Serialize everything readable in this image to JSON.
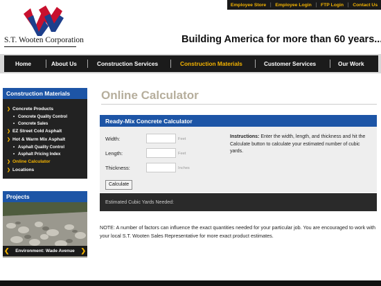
{
  "top_links": [
    "Employee Store",
    "Employee Login",
    "FTP Login",
    "Contact Us"
  ],
  "company": "S.T. Wooten Corporation",
  "tagline": "Building America for more than 60 years...",
  "nav": [
    "Home",
    "About Us",
    "Construction Services",
    "Construction Materials",
    "Customer Services",
    "Our Work"
  ],
  "nav_active": "Construction Materials",
  "sidebar": {
    "title": "Construction Materials",
    "items": [
      {
        "label": "Concrete Products"
      },
      {
        "label": "Concrete Quality Control"
      },
      {
        "label": "Concrete Sales"
      },
      {
        "label": "EZ Street Cold Asphalt"
      },
      {
        "label": "Hot & Warm Mix Asphalt"
      },
      {
        "label": "Asphalt Quality Control"
      },
      {
        "label": "Asphalt Pricing Index"
      },
      {
        "label": "Online Calculator"
      },
      {
        "label": "Locations"
      }
    ]
  },
  "projects": {
    "title": "Projects",
    "caption": "Environment: Wade Avenue"
  },
  "main": {
    "title": "Online Calculator",
    "calculator": {
      "title": "Ready-Mix Concrete Calculator",
      "fields": [
        {
          "label": "Width:",
          "unit": "Feet",
          "value": ""
        },
        {
          "label": "Length:",
          "unit": "Feet",
          "value": ""
        },
        {
          "label": "Thickness:",
          "unit": "Inches",
          "value": ""
        }
      ],
      "instructions_label": "Instructions:",
      "instructions_text": " Enter the width, length, and thickness and hit the Calculate button to calculate your estimated number of cubic yards.",
      "button": "Calculate",
      "result_label": "Estimated Cubic Yards Needed:"
    },
    "note": "NOTE: A number of factors can influence the exact quantities needed for your particular job. You are encouraged to work with your local S.T. Wooten Sales Representative for more exact product estimates."
  },
  "colors": {
    "accent_blue": "#1d55a6",
    "highlight": "#f5b400",
    "dark": "#1b1b1b"
  }
}
